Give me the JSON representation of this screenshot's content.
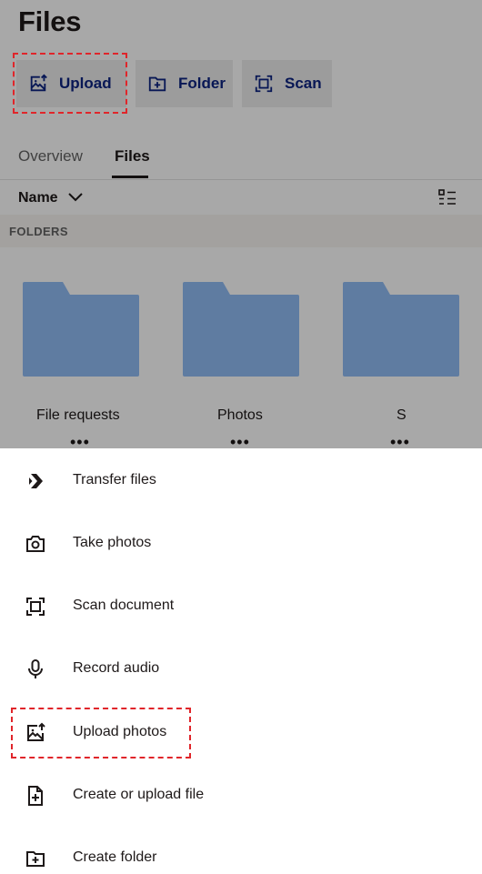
{
  "header": {
    "title": "Files",
    "actions": [
      {
        "label": "Upload",
        "icon": "upload-photo-icon"
      },
      {
        "label": "Folder",
        "icon": "new-folder-icon"
      },
      {
        "label": "Scan",
        "icon": "scan-icon"
      }
    ]
  },
  "tabs": [
    {
      "label": "Overview",
      "active": false
    },
    {
      "label": "Files",
      "active": true
    }
  ],
  "sort": {
    "label": "Name",
    "icon": "chevron-down-icon",
    "view_icon": "list-view-icon"
  },
  "folders_section": {
    "heading": "FOLDERS",
    "items": [
      {
        "name": "File requests",
        "more": "•••"
      },
      {
        "name": "Photos",
        "more": "•••"
      },
      {
        "name": "S",
        "more": "•••"
      }
    ]
  },
  "sheet": {
    "items": [
      {
        "label": "Transfer files",
        "icon": "transfer-icon"
      },
      {
        "label": "Take photos",
        "icon": "camera-icon"
      },
      {
        "label": "Scan document",
        "icon": "scan-icon"
      },
      {
        "label": "Record audio",
        "icon": "microphone-icon"
      },
      {
        "label": "Upload photos",
        "icon": "upload-photo-icon"
      },
      {
        "label": "Create or upload file",
        "icon": "new-file-icon"
      },
      {
        "label": "Create folder",
        "icon": "new-folder-icon"
      }
    ]
  },
  "colors": {
    "accent": "#0d2481",
    "folder": "#91bdf4",
    "highlight": "#e0252a"
  }
}
